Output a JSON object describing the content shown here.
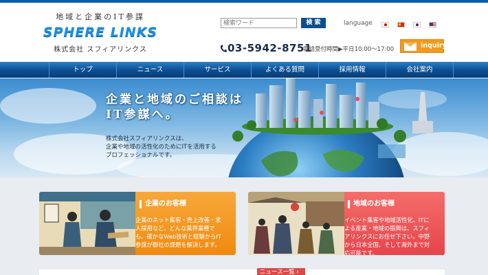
{
  "header": {
    "tagline": "地域と企業のIT参謀",
    "brand": "SPHERE LINKS",
    "company": "株式会社 スフィアリンクス",
    "search_placeholder": "検索ワード",
    "search_button": "検 索",
    "language_label": "language",
    "phone": "03-5942-8751",
    "hours": "電話受付時間▶平日10:00～17:00",
    "inquiry_label": "inquiry"
  },
  "nav": {
    "items": [
      "トップ",
      "ニュース",
      "サービス",
      "よくある質問",
      "採用情報",
      "会社案内"
    ]
  },
  "hero": {
    "headline_1": "企業と地域のご相談は",
    "headline_2": "IT参謀へ。",
    "body_1": "株式会社スフィアリンクスは、",
    "body_2": "企業や地域の活性化のためにITを活用する",
    "body_3": "プロフェッショナルです。"
  },
  "cards": {
    "corp": {
      "title": "企業のお客様",
      "lines": [
        "企業のネット集客・売上改善・求",
        "人採用など、どんな業界業種で",
        "も、確かなWeb技術と経験からIT",
        "参謀が御社の課題を解決します。"
      ]
    },
    "region": {
      "title": "地域のお客様",
      "lines": [
        "イベント集客や地域活性化、ITに",
        "よる産業・地域の振興は、スフィ",
        "アリンクスにお任せ下さい。中野",
        "から日本全国、そして海外まで対",
        "応可能です。"
      ]
    }
  },
  "news": {
    "button_label": "ニュース一覧 ›"
  },
  "colors": {
    "brand_blue": "#1c8fe0",
    "nav_blue": "#0c4f93",
    "inquiry_orange": "#f29a1e",
    "corp_card": "#f08a10",
    "region_card": "#e5454b"
  }
}
